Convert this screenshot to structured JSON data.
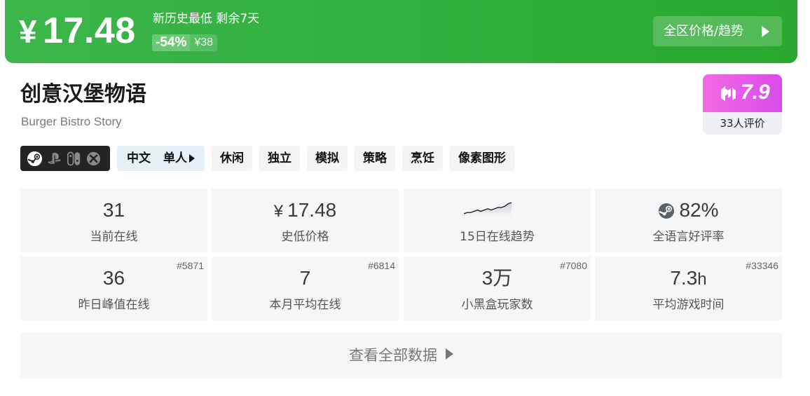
{
  "banner": {
    "currency": "¥",
    "price": "17.48",
    "low_note": "新历史最低 剩余7天",
    "discount": "-54%",
    "original_price": "¥38",
    "region_button": "全区价格/趋势",
    "color": "#2faf3d"
  },
  "game": {
    "title_cn": "创意汉堡物语",
    "title_en": "Burger Bistro Story"
  },
  "score": {
    "value": "7.9",
    "count": "33人评价",
    "logo_icon": "heybox-icon",
    "color": "#e056ea"
  },
  "platforms": [
    "steam-icon",
    "playstation-icon",
    "switch-icon",
    "xbox-icon"
  ],
  "language_tag": {
    "lang": "中文",
    "mode": "单人"
  },
  "tags": [
    "休闲",
    "独立",
    "模拟",
    "策略",
    "烹饪",
    "像素图形"
  ],
  "stats": {
    "online_now": {
      "value": "31",
      "label": "当前在线"
    },
    "lowest_price": {
      "currency": "¥",
      "value": "17.48",
      "label": "史低价格"
    },
    "trend": {
      "label": "15日在线趋势",
      "values": [
        2,
        3,
        3,
        4,
        5,
        4,
        5,
        6,
        5,
        6,
        7,
        7,
        8,
        10,
        11
      ]
    },
    "positive": {
      "value": "82%",
      "label": "全语言好评率",
      "icon": "steam-icon"
    },
    "peak": {
      "value": "36",
      "label": "昨日峰值在线",
      "rank": "#5871"
    },
    "monthly": {
      "value": "7",
      "label": "本月平均在线",
      "rank": "#6814"
    },
    "players": {
      "value": "3万",
      "label": "小黑盒玩家数",
      "rank": "#7080"
    },
    "playtime": {
      "value": "7.3",
      "unit": "h",
      "label": "平均游戏时间",
      "rank": "#33346"
    }
  },
  "view_all": "查看全部数据"
}
